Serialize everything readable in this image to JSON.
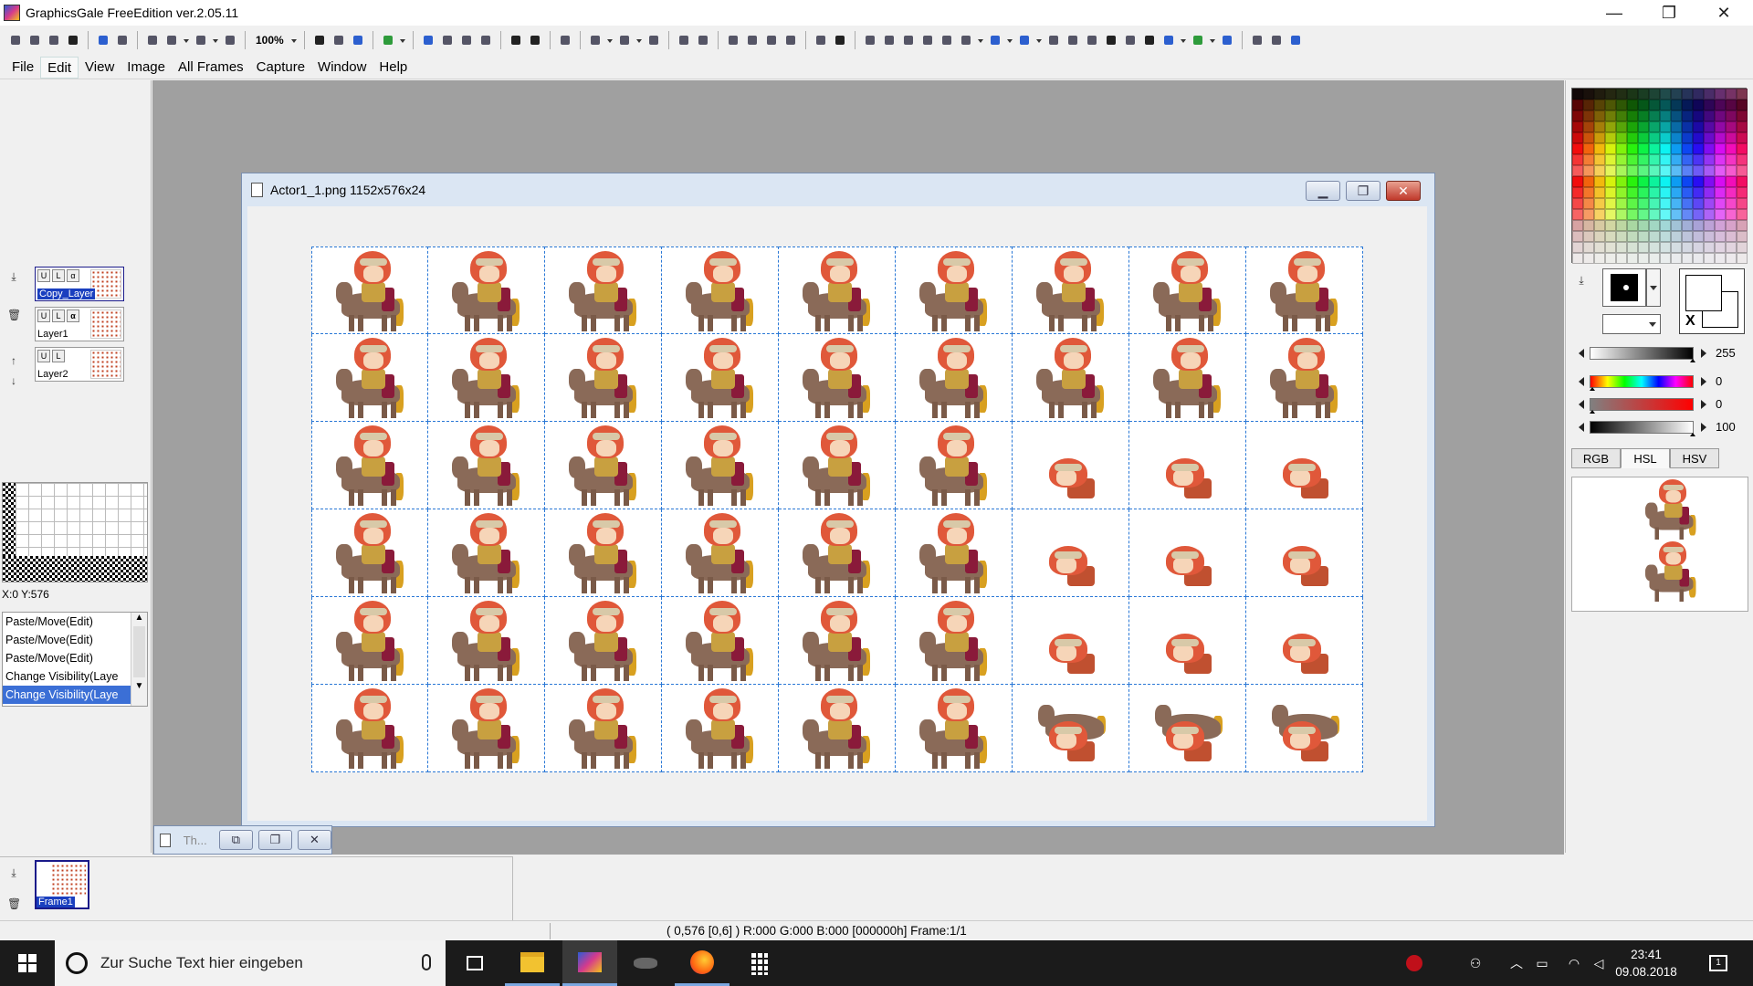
{
  "window": {
    "title": "GraphicsGale FreeEdition ver.2.05.11",
    "minimize": "—",
    "maximize": "❐",
    "close": "✕"
  },
  "toolbar": {
    "zoom": "100%"
  },
  "menu": {
    "items": [
      "File",
      "Edit",
      "View",
      "Image",
      "All Frames",
      "Capture",
      "Window",
      "Help"
    ],
    "active": "Edit"
  },
  "layers": {
    "items": [
      {
        "name": "Copy_Layer",
        "selected": true
      },
      {
        "name": "Layer1",
        "selected": false
      },
      {
        "name": "Layer2",
        "selected": false
      }
    ],
    "alpha_glyph": "α",
    "visibility_glyph": "U",
    "lock_glyph": "L"
  },
  "preview": {
    "coords": "X:0 Y:576"
  },
  "history": {
    "items": [
      {
        "label": "Paste/Move(Edit)",
        "selected": false
      },
      {
        "label": "Paste/Move(Edit)",
        "selected": false
      },
      {
        "label": "Paste/Move(Edit)",
        "selected": false
      },
      {
        "label": "Change Visibility(Laye",
        "selected": false
      },
      {
        "label": "Change Visibility(Laye",
        "selected": true
      }
    ]
  },
  "image_window": {
    "title": "Actor1_1.png 1152x576x24",
    "columns": 9,
    "rows": 6
  },
  "mini_window": {
    "title": "Th..."
  },
  "color_panel": {
    "sliders": [
      {
        "value": "255",
        "knob": 1.0
      },
      {
        "value": "0",
        "knob": 0.0
      },
      {
        "value": "0",
        "knob": 0.0
      },
      {
        "value": "100",
        "knob": 1.0
      }
    ],
    "tabs": [
      "RGB",
      "HSL",
      "HSV"
    ],
    "active_tab": "HSL",
    "bg_swap_label": "X"
  },
  "frames": {
    "label": "Frame1"
  },
  "status": {
    "text": "( 0,576 [0,6] ) R:000 G:000 B:000  [000000h]  Frame:1/1"
  },
  "taskbar": {
    "search_placeholder": "Zur Suche Text hier eingeben",
    "time": "23:41",
    "date": "09.08.2018",
    "notification_count": "1"
  },
  "colors": {
    "grid_line": "#2a78d6",
    "workspace": "#a0a0a0",
    "selection": "#3b6fd6"
  }
}
